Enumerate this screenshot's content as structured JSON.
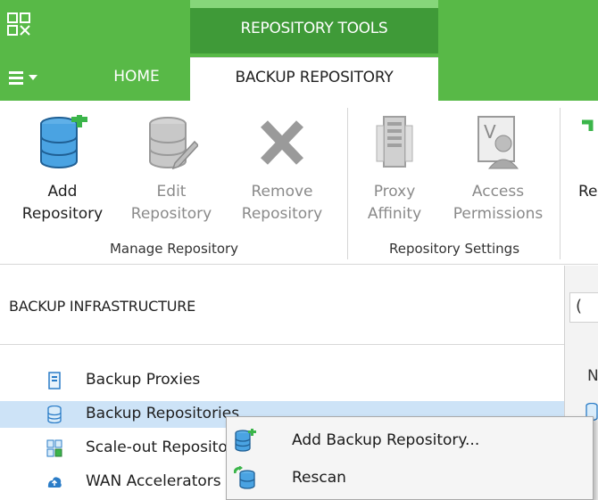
{
  "app": {
    "logo_icon": "veeam-logo-icon",
    "brand_green": "#58b947",
    "context_green": "#3f9a38"
  },
  "ribbon_context": {
    "label": "REPOSITORY TOOLS"
  },
  "tabs": {
    "menu_icon": "hamburger-menu-icon",
    "home": "HOME",
    "backup_repository": "BACKUP REPOSITORY"
  },
  "ribbon": {
    "add_repository": {
      "line1": "Add",
      "line2": "Repository",
      "icon": "database-add-icon"
    },
    "edit_repository": {
      "line1": "Edit",
      "line2": "Repository",
      "icon": "database-edit-icon"
    },
    "remove_repository": {
      "line1": "Remove",
      "line2": "Repository",
      "icon": "remove-x-icon"
    },
    "proxy_affinity": {
      "line1": "Proxy",
      "line2": "Affinity",
      "icon": "server-icon"
    },
    "access_permissions": {
      "line1": "Access",
      "line2": "Permissions",
      "icon": "user-permissions-icon"
    },
    "rescan_partial": {
      "line1": "Re",
      "icon": "rescan-icon"
    },
    "groups": {
      "manage": "Manage Repository",
      "settings": "Repository Settings"
    }
  },
  "left_pane": {
    "header": "BACKUP INFRASTRUCTURE",
    "items": [
      {
        "label": "Backup Proxies",
        "icon": "proxy-icon"
      },
      {
        "label": "Backup Repositories",
        "icon": "repository-icon",
        "selected": true
      },
      {
        "label": "Scale-out Repositories",
        "icon": "scaleout-repository-icon"
      },
      {
        "label": "WAN Accelerators",
        "icon": "wan-accelerator-icon"
      }
    ]
  },
  "right_pane": {
    "search_glyph": "(",
    "column_header": "N"
  },
  "context_menu": {
    "items": [
      {
        "label": "Add Backup Repository...",
        "icon": "database-add-icon"
      },
      {
        "label": "Rescan",
        "icon": "rescan-icon"
      }
    ]
  }
}
